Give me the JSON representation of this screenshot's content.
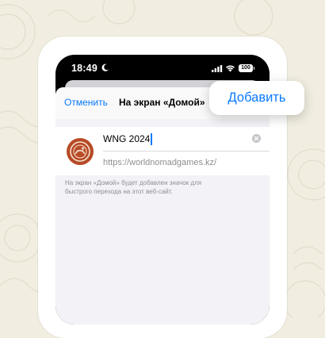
{
  "status_bar": {
    "time": "18:49",
    "battery": "100",
    "icons": [
      "moon-icon",
      "cellular-icon",
      "wifi-icon",
      "battery-icon"
    ]
  },
  "sheet": {
    "cancel_label": "Отменить",
    "title": "На экран «Домой»",
    "name_value": "WNG 2024",
    "url": "https://worldnomadgames.kz/",
    "description": "На экран «Домой» будет добавлен значок для быстрого перехода на этот веб-сайт."
  },
  "add_button": {
    "label": "Добавить"
  },
  "colors": {
    "accent": "#0a7aff",
    "app_icon": "#b84a26",
    "background": "#f1eee1",
    "sheet": "#f2f2f7"
  }
}
